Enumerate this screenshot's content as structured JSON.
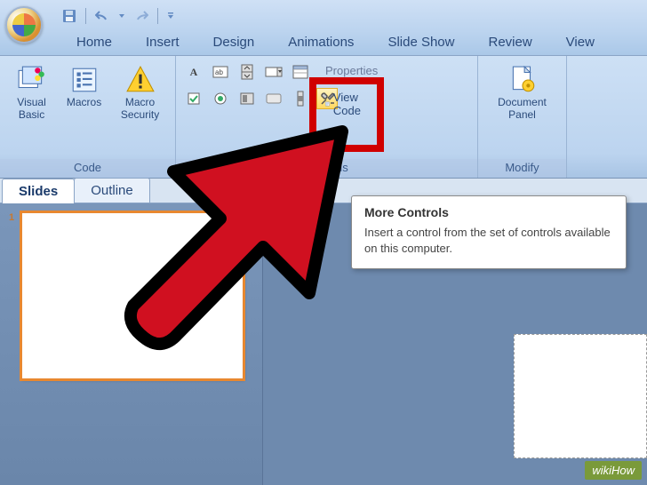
{
  "qat": {
    "save": "save-icon",
    "undo": "undo-icon",
    "redo": "redo-icon"
  },
  "tabs": [
    "Home",
    "Insert",
    "Design",
    "Animations",
    "Slide Show",
    "Review",
    "View"
  ],
  "ribbon": {
    "code": {
      "label": "Code",
      "visual_basic": "Visual Basic",
      "macros": "Macros",
      "macro_security": "Macro Security"
    },
    "controls": {
      "label": "Controls",
      "side": {
        "properties": "Properties",
        "view_code": "View Code"
      }
    },
    "modify": {
      "label": "Modify",
      "document_panel": "Document Panel"
    }
  },
  "panel_tabs": {
    "slides": "Slides",
    "outline": "Outline"
  },
  "slide_thumb": {
    "number": "1"
  },
  "tooltip": {
    "title": "More Controls",
    "body": "Insert a control from the set of controls available on this computer."
  },
  "watermark": "wikiHow"
}
